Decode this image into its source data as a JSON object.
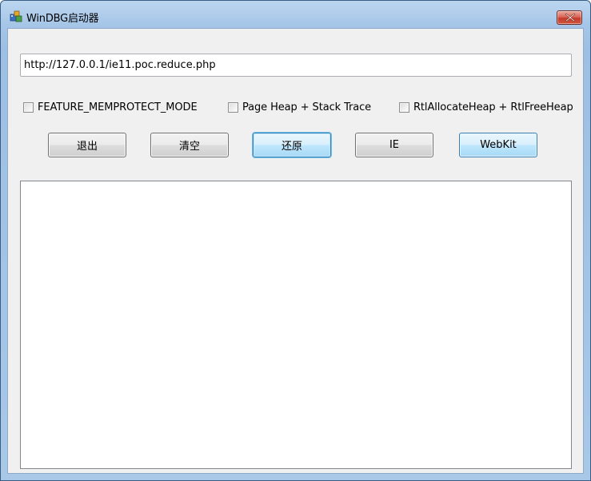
{
  "window": {
    "title": "WinDBG启动器",
    "close_symbol": "✕"
  },
  "url_field": {
    "value": "http://127.0.0.1/ie11.poc.reduce.php"
  },
  "options": [
    {
      "label": "FEATURE_MEMPROTECT_MODE",
      "checked": false
    },
    {
      "label": "Page Heap + Stack Trace",
      "checked": false
    },
    {
      "label": "RtlAllocateHeap + RtlFreeHeap",
      "checked": false
    }
  ],
  "buttons": [
    {
      "label": "退出"
    },
    {
      "label": "清空"
    },
    {
      "label": "还原"
    },
    {
      "label": "IE"
    },
    {
      "label": "WebKit"
    }
  ],
  "output": {
    "text": ""
  }
}
